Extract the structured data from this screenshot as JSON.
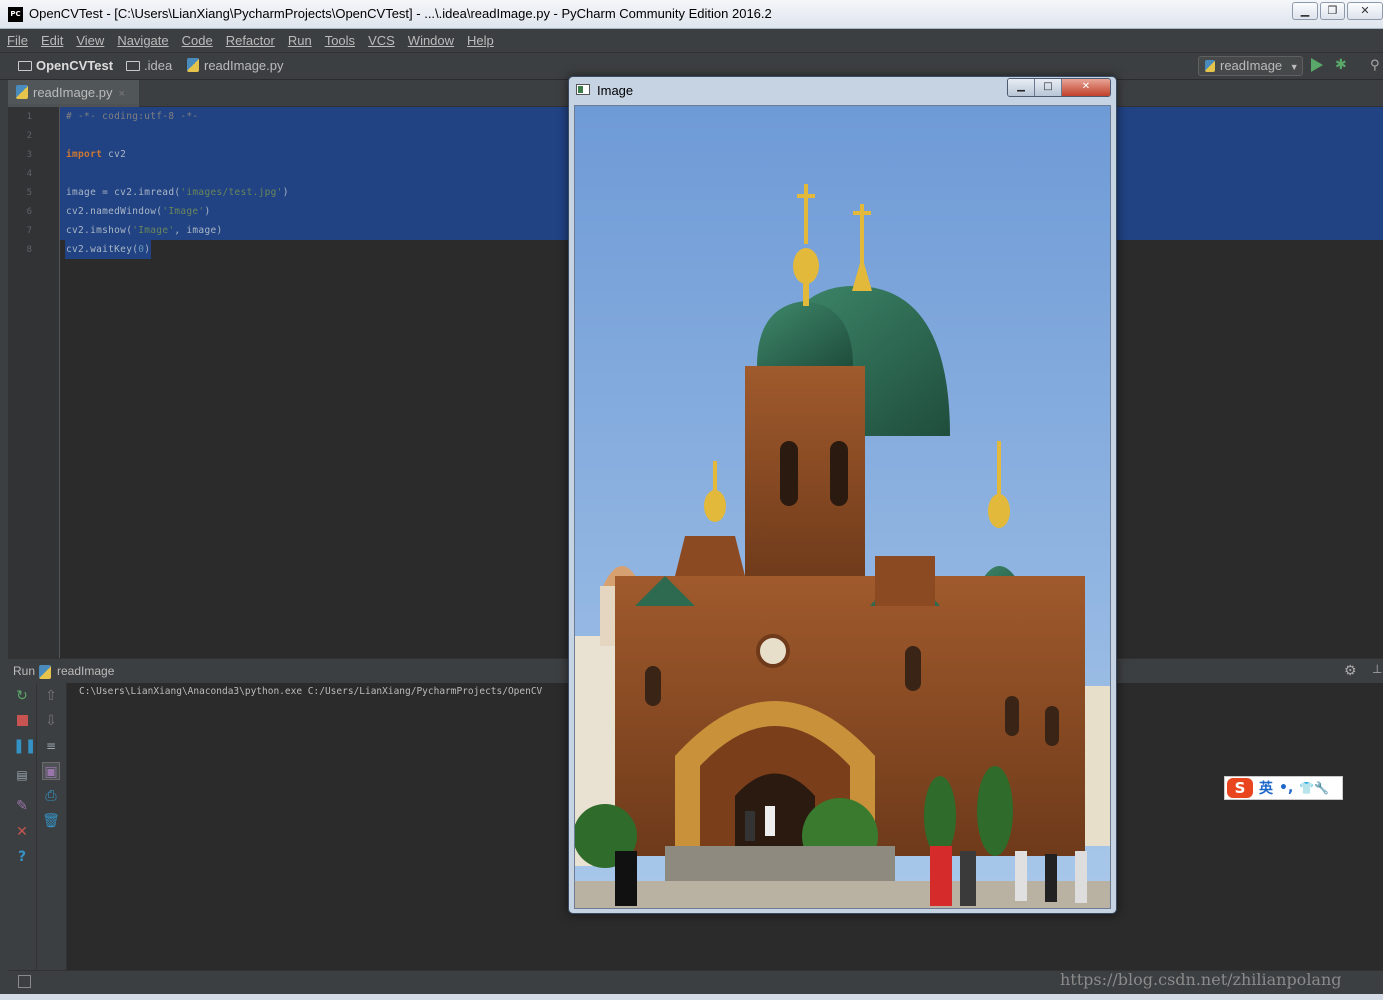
{
  "window": {
    "app_icon_text": "PC",
    "title": "OpenCVTest - [C:\\Users\\LianXiang\\PycharmProjects\\OpenCVTest] - ...\\.idea\\readImage.py - PyCharm Community Edition 2016.2",
    "minimize_icon": "minimize-icon",
    "maximize_icon": "restore-icon",
    "close_icon": "close-icon"
  },
  "menu": [
    "File",
    "Edit",
    "View",
    "Navigate",
    "Code",
    "Refactor",
    "Run",
    "Tools",
    "VCS",
    "Window",
    "Help"
  ],
  "navbar": {
    "project": "OpenCVTest",
    "folder": ".idea",
    "file": "readImage.py",
    "run_config": "readImage"
  },
  "tabs": [
    {
      "label": "readImage.py",
      "close": "×"
    }
  ],
  "editor": {
    "line_numbers": [
      "1",
      "2",
      "3",
      "4",
      "5",
      "6",
      "7",
      "8"
    ],
    "lines": {
      "l1": "# -*- coding:utf-8 -*-",
      "l3_kw": "import",
      "l3_rest": " cv2",
      "l5_a": "image = cv2.imread(",
      "l5_str": "'images/test.jpg'",
      "l5_b": ")",
      "l6_a": "cv2.namedWindow(",
      "l6_str": "'Image'",
      "l6_b": ")",
      "l7_a": "cv2.imshow(",
      "l7_str": "'Image'",
      "l7_b": ", image)",
      "l8_a": "cv2.waitKey(",
      "l8_num": "0",
      "l8_b": ")"
    }
  },
  "run_panel": {
    "label": "Run",
    "config": "readImage",
    "console_line": "C:\\Users\\LianXiang\\Anaconda3\\python.exe C:/Users/LianXiang/PycharmProjects/OpenCV"
  },
  "image_window": {
    "title": "Image",
    "minimize": "▁",
    "maximize": "□",
    "close": "✕"
  },
  "ime": {
    "logo": "S",
    "lang": "英",
    "punct": "•,",
    "icons": "👕🔧"
  },
  "watermark": "https://blog.csdn.net/zhilianpolang",
  "colors": {
    "selection": "#214283",
    "keyword": "#cc7832",
    "string": "#6a8759",
    "number": "#6897bb",
    "sky": "#7fa9df",
    "brick": "#8a4a22",
    "dome_green": "#2d6a4f",
    "gold": "#e2b93b"
  }
}
